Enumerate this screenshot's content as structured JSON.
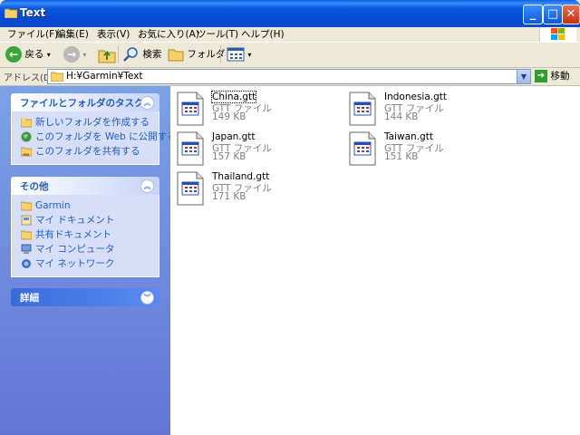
{
  "window": {
    "title": "Text"
  },
  "menu": [
    "ファイル(F)",
    "編集(E)",
    "表示(V)",
    "お気に入り(A)",
    "ツール(T)",
    "ヘルプ(H)"
  ],
  "toolbar": {
    "back": "戻る",
    "search": "検索",
    "folders": "フォルダ"
  },
  "address": {
    "label": "アドレス(D)",
    "value": "H:¥Garmin¥Text",
    "go": "移動"
  },
  "tasks": {
    "title": "ファイルとフォルダのタスク",
    "items": [
      "新しいフォルダを作成する",
      "このフォルダを Web に公開する",
      "このフォルダを共有する"
    ]
  },
  "other": {
    "title": "その他",
    "items": [
      "Garmin",
      "マイ ドキュメント",
      "共有ドキュメント",
      "マイ コンピュータ",
      "マイ ネットワーク"
    ]
  },
  "details": {
    "title": "詳細"
  },
  "files": [
    {
      "name": "China.gtt",
      "type": "GTT ファイル",
      "size": "149 KB"
    },
    {
      "name": "Indonesia.gtt",
      "type": "GTT ファイル",
      "size": "144 KB"
    },
    {
      "name": "Japan.gtt",
      "type": "GTT ファイル",
      "size": "157 KB"
    },
    {
      "name": "Taiwan.gtt",
      "type": "GTT ファイル",
      "size": "151 KB"
    },
    {
      "name": "Thailand.gtt",
      "type": "GTT ファイル",
      "size": "171 KB"
    }
  ],
  "colors": {
    "titlebar": "#0A5FE8",
    "sidebar_top": "#7BA2E7",
    "sidebar_bottom": "#6375D6",
    "link": "#215DC6"
  }
}
